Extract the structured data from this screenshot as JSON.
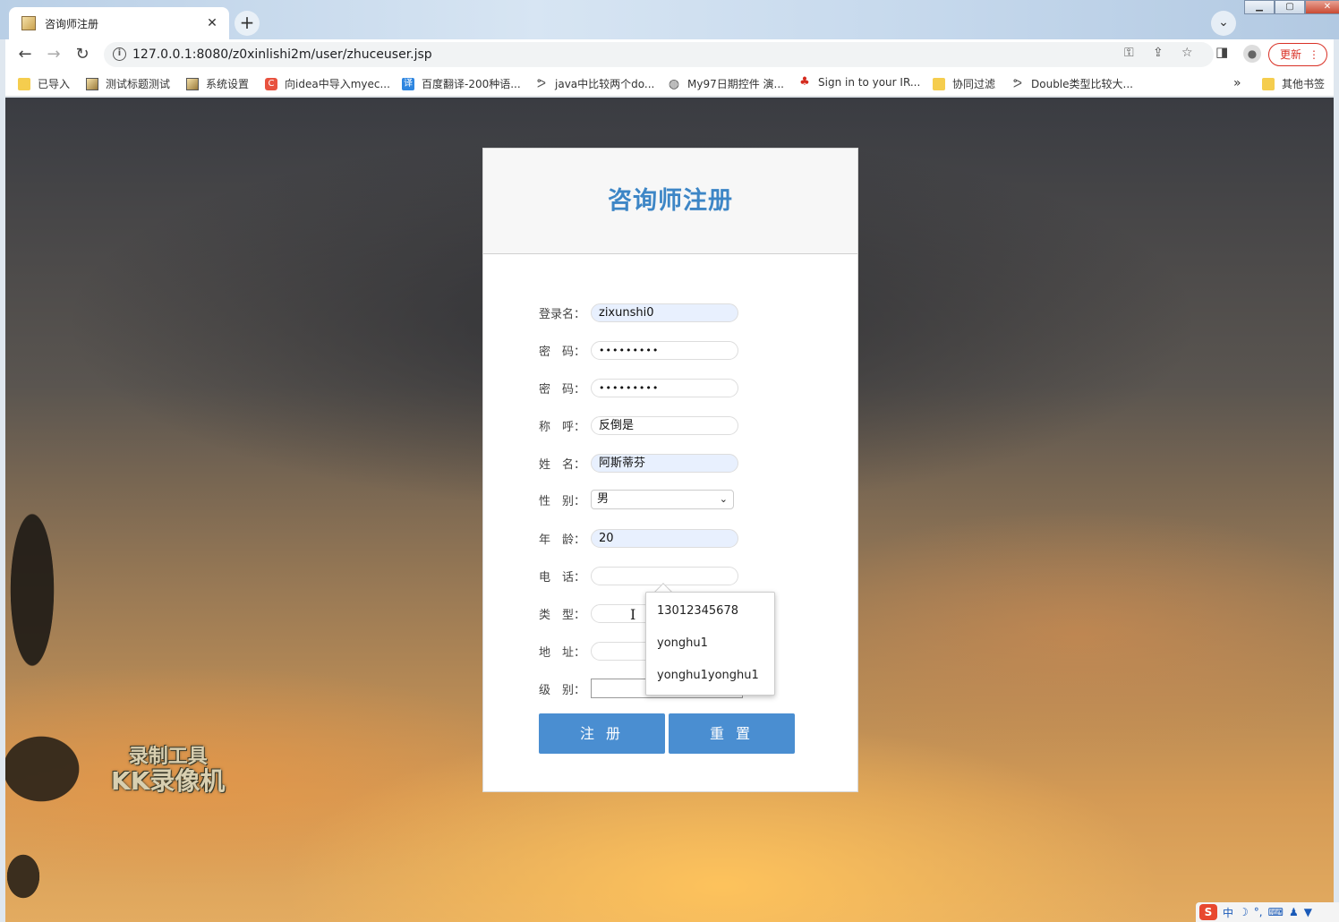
{
  "browser": {
    "tab_title": "咨询师注册",
    "tab_close": "✕",
    "new_tab": "+",
    "tab_search": "⌄",
    "url": "127.0.0.1:8080/z0xinlishi2m/user/zhuceuser.jsp",
    "update_label": "更新",
    "bookmarks": [
      {
        "label": "已导入",
        "icon": "folder-icon"
      },
      {
        "label": "测试标题测试",
        "icon": "image-icon"
      },
      {
        "label": "系统设置",
        "icon": "image-icon"
      },
      {
        "label": "向idea中导入myec...",
        "icon": "c-icon"
      },
      {
        "label": "百度翻译-200种语...",
        "icon": "translate-icon"
      },
      {
        "label": "java中比较两个do...",
        "icon": "glyph-icon"
      },
      {
        "label": "My97日期控件 演...",
        "icon": "globe-icon"
      },
      {
        "label": "Sign in to your IR...",
        "icon": "maple-leaf-icon"
      },
      {
        "label": "协同过滤",
        "icon": "folder-icon"
      },
      {
        "label": "Double类型比较大...",
        "icon": "glyph-icon"
      }
    ],
    "bookmarks_more": "»",
    "other_bookmarks": "其他书签"
  },
  "watermark": {
    "line1": "录制工具",
    "line2": "KK录像机"
  },
  "form": {
    "title": "咨询师注册",
    "fields": {
      "login": {
        "label": "登录名：",
        "value": "zixunshi0"
      },
      "password": {
        "label": "密　码：",
        "value": "•••••••••"
      },
      "confirm": {
        "label": "密　码：",
        "value": "•••••••••"
      },
      "nickname": {
        "label": "称　呼：",
        "value": "反倒是"
      },
      "name": {
        "label": "姓　名：",
        "value": "阿斯蒂芬"
      },
      "gender": {
        "label": "性　别：",
        "value": "男"
      },
      "age": {
        "label": "年　龄：",
        "value": "20"
      },
      "phone": {
        "label": "电　话：",
        "value": ""
      },
      "type": {
        "label": "类　型：",
        "value": ""
      },
      "address": {
        "label": "地　址：",
        "value": ""
      },
      "level": {
        "label": "级　别：",
        "value": ""
      }
    },
    "submit_label": "注 册",
    "reset_label": "重 置"
  },
  "autocomplete": [
    "13012345678",
    "yonghu1",
    "yonghu1yonghu1"
  ],
  "ime": {
    "mode": "中"
  }
}
